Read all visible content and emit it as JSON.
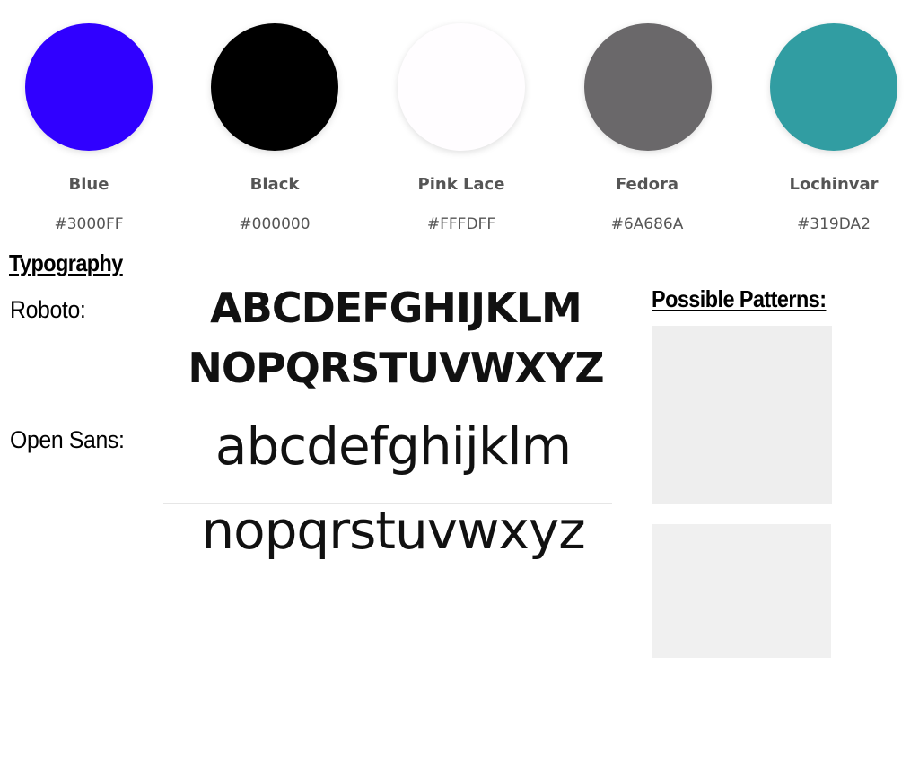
{
  "palette": [
    {
      "name": "Blue",
      "hex": "#3000FF",
      "color": "#3000FF"
    },
    {
      "name": "Black",
      "hex": "#000000",
      "color": "#000000"
    },
    {
      "name": "Pink Lace",
      "hex": "#FFFDFF",
      "color": "#FFFDFF"
    },
    {
      "name": "Fedora",
      "hex": "#6A686A",
      "color": "#6A686A"
    },
    {
      "name": "Lochinvar",
      "hex": "#319DA2",
      "color": "#319DA2"
    }
  ],
  "typography": {
    "heading": "Typography",
    "fonts": [
      {
        "label": "Roboto:",
        "line1": "ABCDEFGHIJKLM",
        "line2": "NOPQRSTUVWXYZ"
      },
      {
        "label": "Open Sans:",
        "line1": "abcdefghijklm",
        "line2": "nopqrstuvwxyz"
      }
    ]
  },
  "patterns": {
    "heading": "Possible Patterns:",
    "colors": [
      "#eeeeee",
      "#f0f0f0"
    ]
  }
}
